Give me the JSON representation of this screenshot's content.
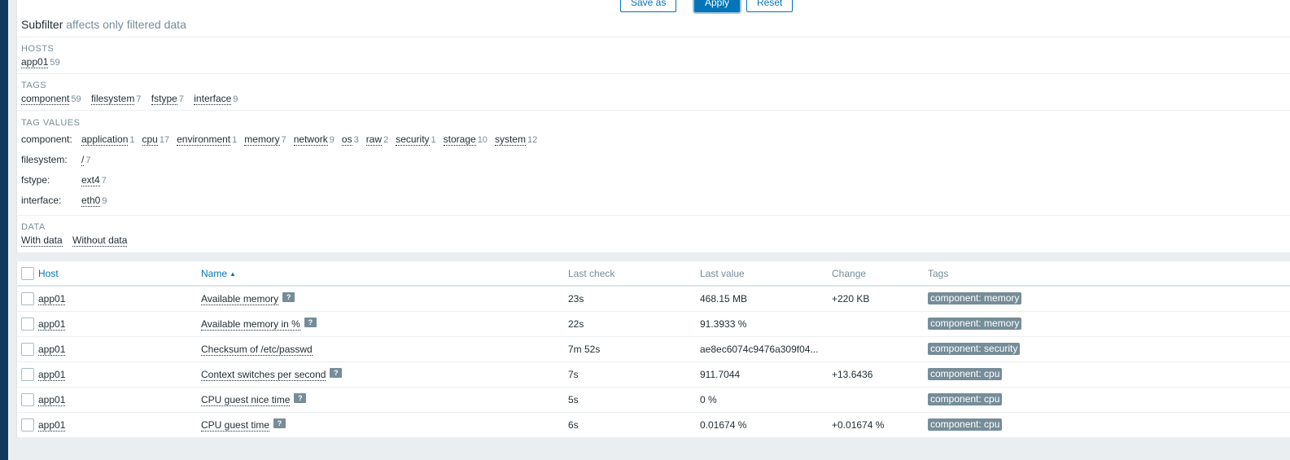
{
  "buttons": {
    "save_as": "Save as",
    "apply": "Apply",
    "reset": "Reset"
  },
  "subfilter": {
    "title": "Subfilter",
    "hint": "affects only filtered data"
  },
  "hosts": {
    "heading": "HOSTS",
    "items": [
      {
        "label": "app01",
        "count": "59"
      }
    ]
  },
  "tags": {
    "heading": "TAGS",
    "items": [
      {
        "label": "component",
        "count": "59"
      },
      {
        "label": "filesystem",
        "count": "7"
      },
      {
        "label": "fstype",
        "count": "7"
      },
      {
        "label": "interface",
        "count": "9"
      }
    ]
  },
  "tag_values": {
    "heading": "TAG VALUES",
    "rows": [
      {
        "name": "component:",
        "values": [
          {
            "label": "application",
            "count": "1"
          },
          {
            "label": "cpu",
            "count": "17"
          },
          {
            "label": "environment",
            "count": "1"
          },
          {
            "label": "memory",
            "count": "7"
          },
          {
            "label": "network",
            "count": "9"
          },
          {
            "label": "os",
            "count": "3"
          },
          {
            "label": "raw",
            "count": "2"
          },
          {
            "label": "security",
            "count": "1"
          },
          {
            "label": "storage",
            "count": "10"
          },
          {
            "label": "system",
            "count": "12"
          }
        ]
      },
      {
        "name": "filesystem:",
        "values": [
          {
            "label": "/",
            "count": "7"
          }
        ]
      },
      {
        "name": "fstype:",
        "values": [
          {
            "label": "ext4",
            "count": "7"
          }
        ]
      },
      {
        "name": "interface:",
        "values": [
          {
            "label": "eth0",
            "count": "9"
          }
        ]
      }
    ]
  },
  "data_filter": {
    "heading": "DATA",
    "items": [
      {
        "label": "With data"
      },
      {
        "label": "Without data"
      }
    ]
  },
  "table": {
    "columns": {
      "host": "Host",
      "name": "Name",
      "last_check": "Last check",
      "last_value": "Last value",
      "change": "Change",
      "tags": "Tags"
    },
    "sort_indicator": "▲",
    "rows": [
      {
        "host": "app01",
        "name": "Available memory",
        "help": true,
        "last_check": "23s",
        "last_value": "468.15 MB",
        "change": "+220 KB",
        "tag": "component: memory"
      },
      {
        "host": "app01",
        "name": "Available memory in %",
        "help": true,
        "last_check": "22s",
        "last_value": "91.3933 %",
        "change": "",
        "tag": "component: memory"
      },
      {
        "host": "app01",
        "name": "Checksum of /etc/passwd",
        "help": false,
        "last_check": "7m 52s",
        "last_value": "ae8ec6074c9476a309f04...",
        "change": "",
        "tag": "component: security"
      },
      {
        "host": "app01",
        "name": "Context switches per second",
        "help": true,
        "last_check": "7s",
        "last_value": "911.7044",
        "change": "+13.6436",
        "tag": "component: cpu"
      },
      {
        "host": "app01",
        "name": "CPU guest nice time",
        "help": true,
        "last_check": "5s",
        "last_value": "0 %",
        "change": "",
        "tag": "component: cpu"
      },
      {
        "host": "app01",
        "name": "CPU guest time",
        "help": true,
        "last_check": "6s",
        "last_value": "0.01674 %",
        "change": "+0.01674 %",
        "tag": "component: cpu"
      }
    ]
  },
  "icons": {
    "help": "?"
  },
  "colors": {
    "sidebar": "#0e3b59",
    "accent": "#0275b8",
    "tag_bg": "#768d99"
  }
}
